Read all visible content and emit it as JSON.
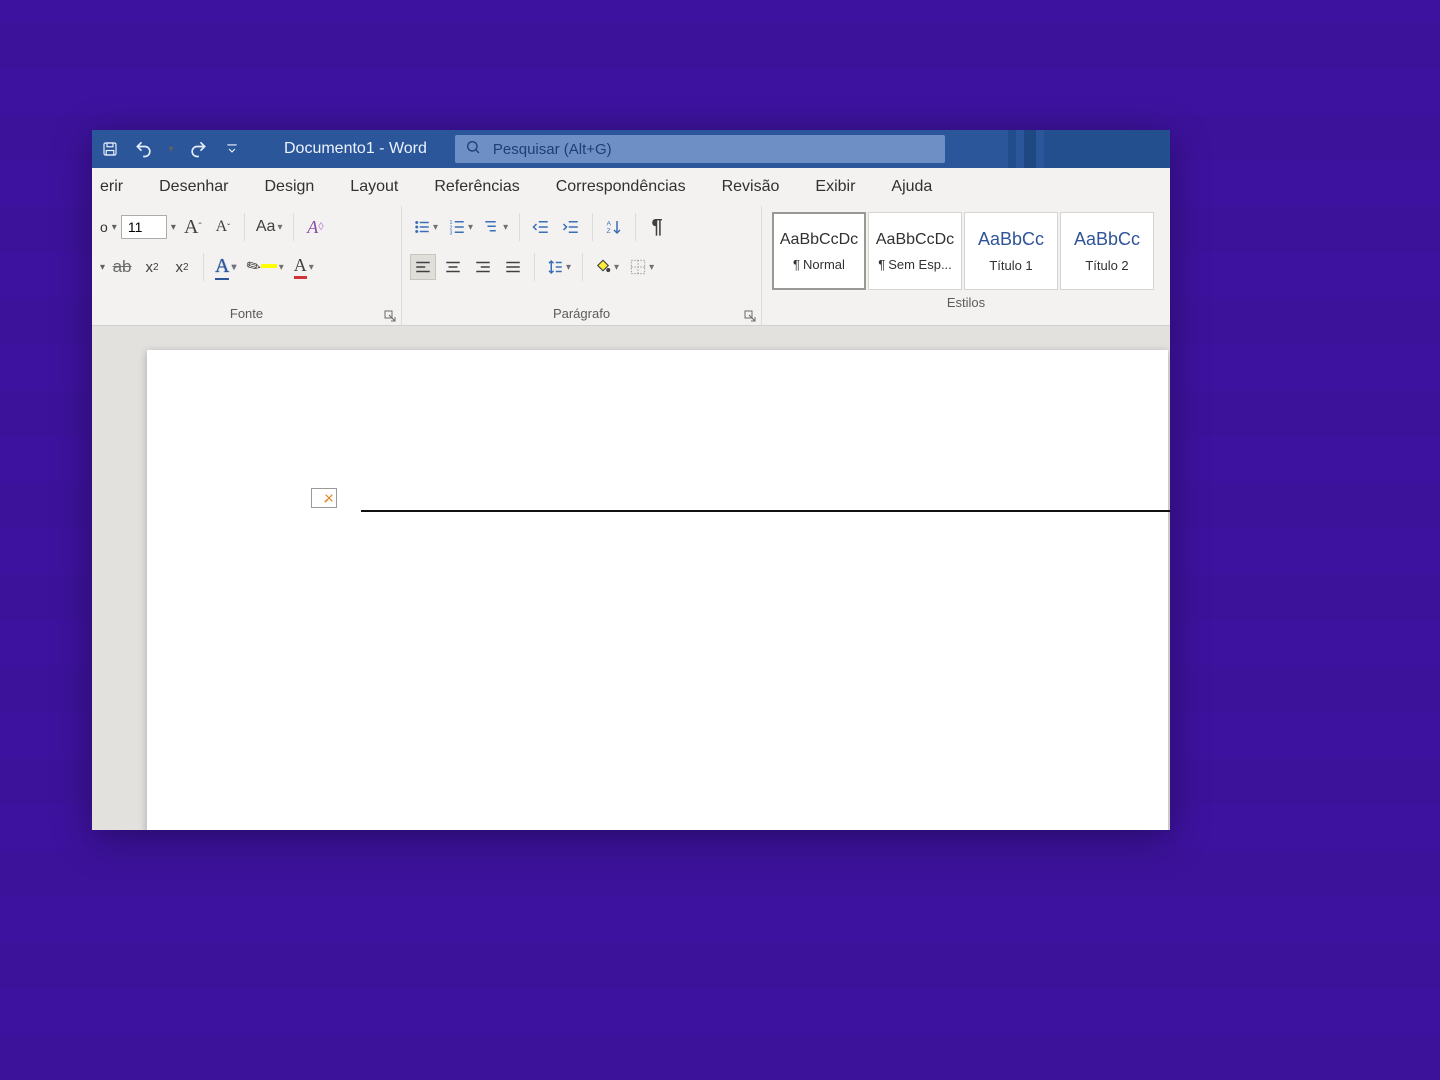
{
  "title": "Documento1 - Word",
  "search": {
    "placeholder": "Pesquisar (Alt+G)"
  },
  "tabs": [
    "erir",
    "Desenhar",
    "Design",
    "Layout",
    "Referências",
    "Correspondências",
    "Revisão",
    "Exibir",
    "Ajuda"
  ],
  "font": {
    "size": "11",
    "name_suffix": "o",
    "group_label": "Fonte"
  },
  "paragraph": {
    "group_label": "Parágrafo"
  },
  "styles": {
    "group_label": "Estilos",
    "preview": "AaBbCcDc",
    "preview_heading": "AaBbCc",
    "items": [
      {
        "name": "Normal",
        "pilcrow": "¶"
      },
      {
        "name": "Sem Esp...",
        "pilcrow": "¶"
      },
      {
        "name": "Título 1"
      },
      {
        "name": "Título 2"
      }
    ]
  }
}
